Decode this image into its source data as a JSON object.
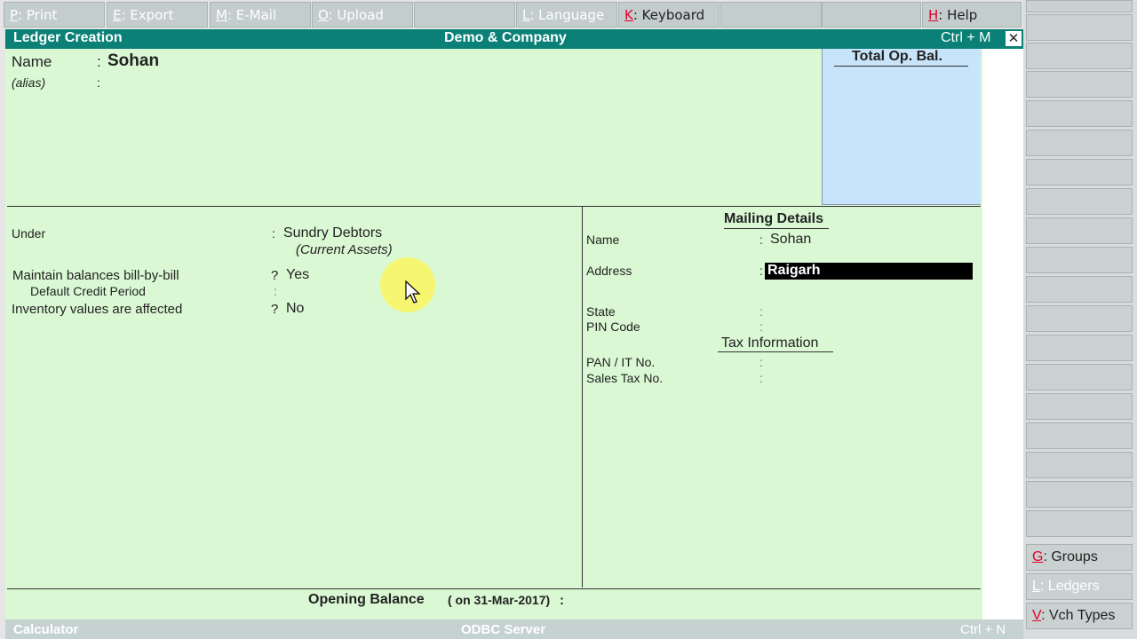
{
  "top_buttons": [
    {
      "key": "P",
      "label": ": Print",
      "active": false
    },
    {
      "key": "E",
      "label": ": Export",
      "active": false
    },
    {
      "key": "M",
      "label": ": E-Mail",
      "active": false
    },
    {
      "key": "O",
      "label": ": Upload",
      "active": false
    },
    {
      "key": "",
      "label": "",
      "active": false
    },
    {
      "key": "L",
      "label": ": Language",
      "active": false
    },
    {
      "key": "K",
      "label": ": Keyboard",
      "active": true
    },
    {
      "key": "",
      "label": "",
      "active": false
    },
    {
      "key": "",
      "label": "",
      "active": false
    },
    {
      "key": "H",
      "label": ": Help",
      "active": true
    }
  ],
  "titlebar": {
    "left": "Ledger Creation",
    "center": "Demo & Company",
    "shortcut": "Ctrl + M",
    "close": "✕"
  },
  "header": {
    "name_label": "Name",
    "name_colon": ":",
    "name_value": "Sohan",
    "alias_label": "(alias)",
    "alias_colon": ":",
    "opbal_title": "Total Op. Bal."
  },
  "left": {
    "under_label": "Under",
    "under_colon": ":",
    "under_value": "Sundry Debtors",
    "under_sub": "(Current Assets)",
    "bbb_label": "Maintain balances bill-by-bill",
    "bbb_q": "?",
    "bbb_value": "Yes",
    "credit_label": "Default Credit Period",
    "credit_colon": ":",
    "inv_label": "Inventory values are affected",
    "inv_q": "?",
    "inv_value": "No"
  },
  "right": {
    "mailing_title": "Mailing Details",
    "name_label": "Name",
    "name_colon": ":",
    "name_value": "Sohan",
    "address_label": "Address",
    "address_colon": ":",
    "address_value": "Raigarh",
    "state_label": "State",
    "state_colon": ":",
    "pin_label": "PIN Code",
    "pin_colon": ":",
    "tax_title": "Tax Information",
    "pan_label": "PAN / IT No.",
    "pan_colon": ":",
    "stax_label": "Sales Tax No.",
    "stax_colon": ":"
  },
  "opening": {
    "label": "Opening Balance",
    "date": "( on 31-Mar-2017)",
    "colon": ":"
  },
  "bottombar": {
    "left": "Calculator",
    "center": "ODBC Server",
    "right": "Ctrl + N"
  },
  "sidebar": {
    "groups": {
      "key": "G",
      "label": ": Groups"
    },
    "ledgers": {
      "key": "L",
      "label": ": Ledgers"
    },
    "vch": {
      "key": "V",
      "label": ": Vch Types"
    }
  },
  "colors": {
    "title": "#0a8077",
    "body": "#daf8d4",
    "opbal": "#c8e4fa",
    "hotkey": "#e4002b"
  }
}
